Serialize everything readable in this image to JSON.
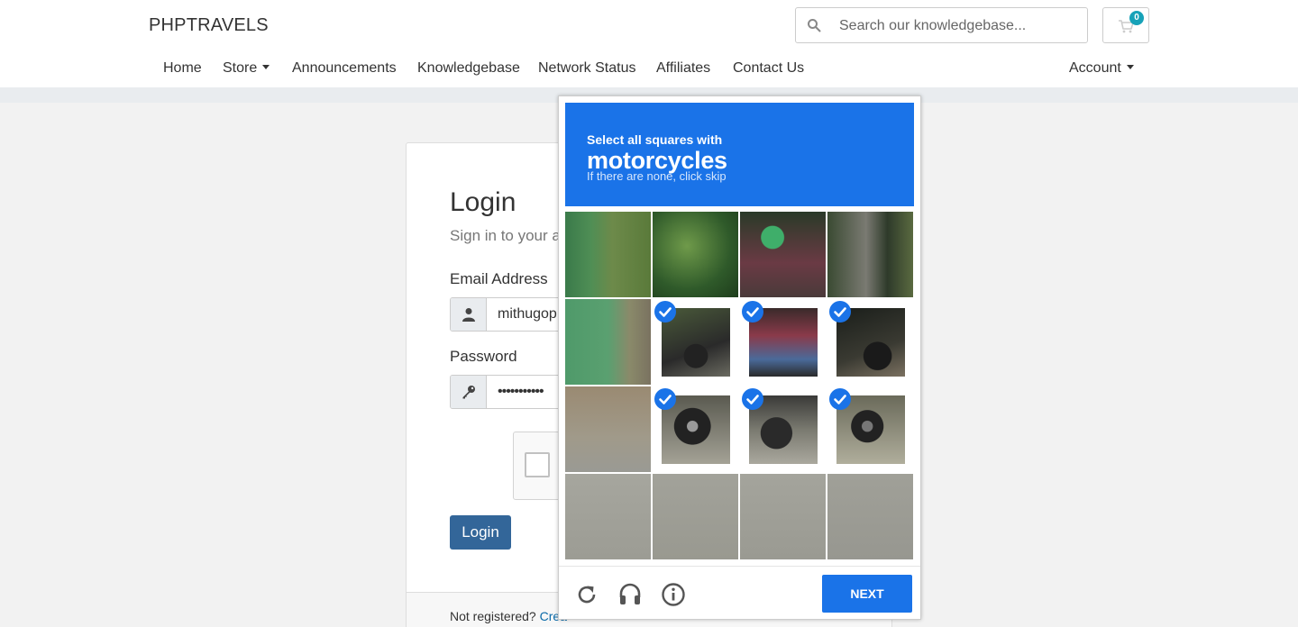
{
  "header": {
    "brand": "PHPTRAVELS",
    "search_placeholder": "Search our knowledgebase...",
    "cart_count": "0"
  },
  "nav": {
    "home": "Home",
    "store": "Store",
    "announcements": "Announcements",
    "knowledgebase": "Knowledgebase",
    "network_status": "Network Status",
    "affiliates": "Affiliates",
    "contact_us": "Contact Us",
    "account": "Account"
  },
  "login": {
    "title": "Login",
    "subtitle": "Sign in to your a",
    "email_label": "Email Address",
    "email_value": "mithugop",
    "password_label": "Password",
    "password_value": "•••••••••••",
    "button": "Login",
    "footer_text": "Not registered?",
    "footer_link": "Crea"
  },
  "captcha": {
    "instruction": "Select all squares with",
    "target": "motorcycles",
    "hint": "If there are none, click skip",
    "next_button": "NEXT",
    "accent_color": "#1a73e8",
    "tiles": [
      {
        "content": "green wall and palm leaves",
        "selected": false
      },
      {
        "content": "palm foliage",
        "selected": false
      },
      {
        "content": "rider with green helmet",
        "selected": false
      },
      {
        "content": "tree trunk and rider",
        "selected": false
      },
      {
        "content": "green wall",
        "selected": false
      },
      {
        "content": "motorcycle",
        "selected": true
      },
      {
        "content": "rider on motorcycle",
        "selected": true
      },
      {
        "content": "motorcycle rear",
        "selected": true
      },
      {
        "content": "road",
        "selected": false
      },
      {
        "content": "motorcycle wheel",
        "selected": true
      },
      {
        "content": "motorcycle wheel and shoe",
        "selected": true
      },
      {
        "content": "motorcycle wheel",
        "selected": true
      },
      {
        "content": "road",
        "selected": false
      },
      {
        "content": "road",
        "selected": false
      },
      {
        "content": "road",
        "selected": false
      },
      {
        "content": "road",
        "selected": false
      }
    ]
  }
}
